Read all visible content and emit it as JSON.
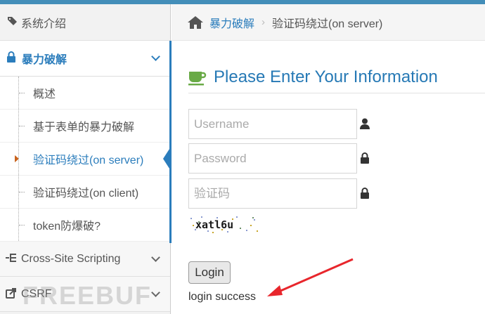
{
  "sidebar": {
    "header": "系统介绍",
    "group": "暴力破解",
    "items": [
      {
        "label": "概述"
      },
      {
        "label": "基于表单的暴力破解"
      },
      {
        "label": "验证码绕过(on server)"
      },
      {
        "label": "验证码绕过(on client)"
      },
      {
        "label": "token防爆破?"
      }
    ],
    "other": [
      {
        "label": "Cross-Site Scripting"
      },
      {
        "label": "CSRF"
      }
    ]
  },
  "breadcrumb": {
    "parent": "暴力破解",
    "current": "验证码绕过(on server)"
  },
  "form": {
    "title": "Please Enter Your Information",
    "username_placeholder": "Username",
    "password_placeholder": "Password",
    "captcha_placeholder": "验证码",
    "captcha_text": "xatl6u",
    "login_label": "Login",
    "status": "login success"
  },
  "watermark": "FREEBUF",
  "colors": {
    "accent": "#2b7dbc",
    "title": "#2679b5",
    "cup": "#69aa46",
    "arrow": "#e8262c"
  }
}
